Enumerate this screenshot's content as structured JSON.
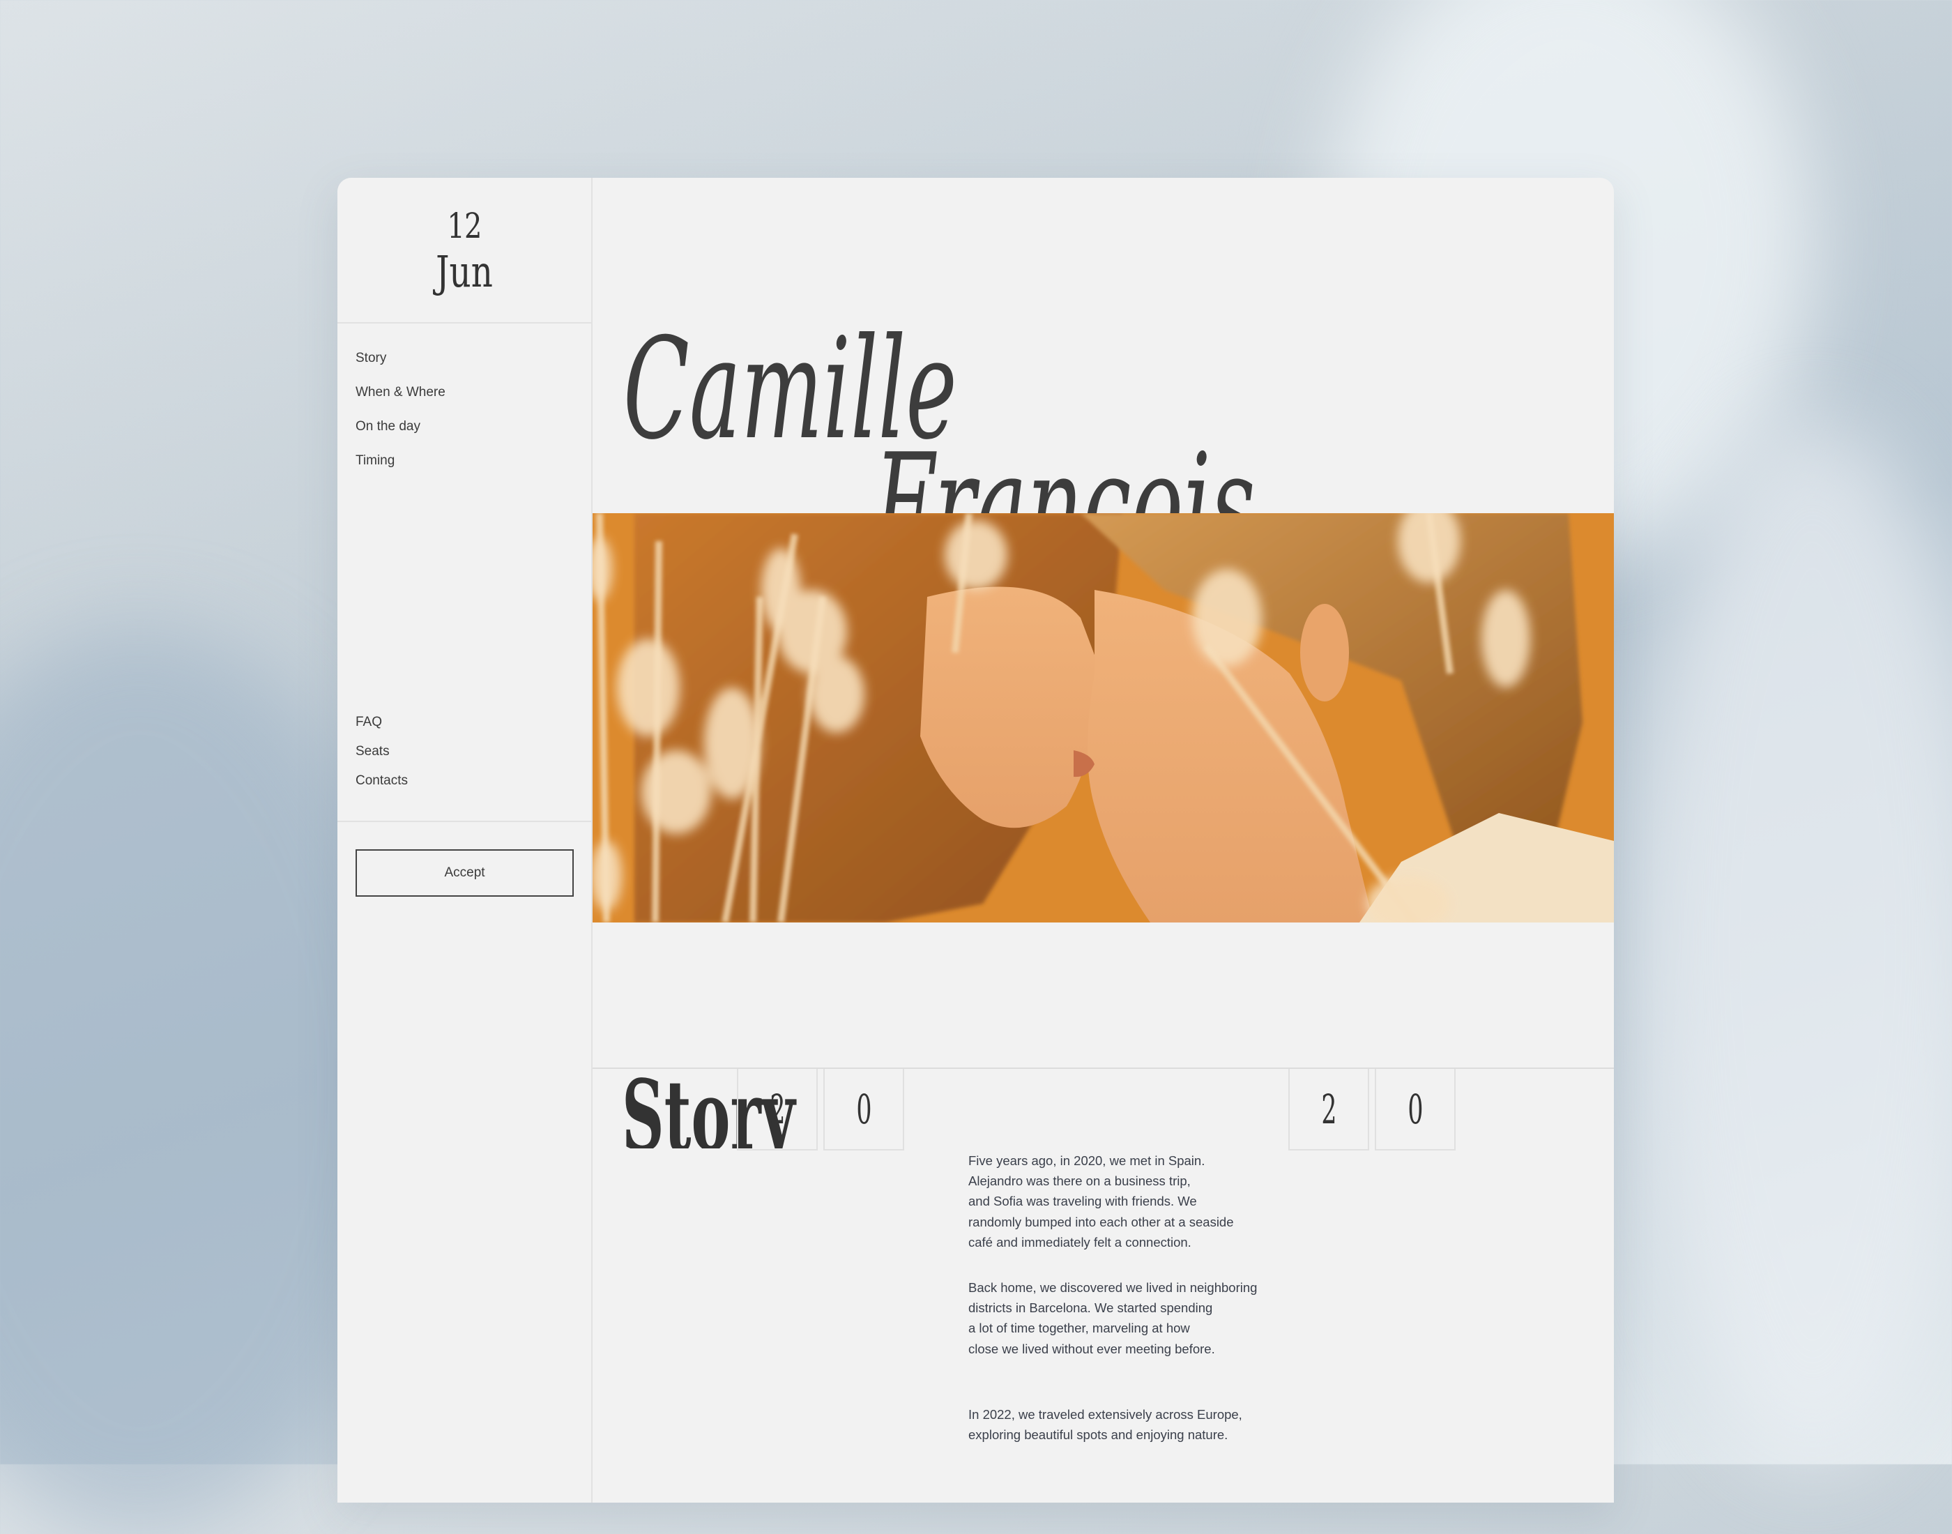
{
  "sidebar": {
    "date": {
      "day": "12",
      "month": "Jun"
    },
    "nav_top": [
      "Story",
      "When & Where",
      "On the day",
      "Timing"
    ],
    "nav_bottom": [
      "FAQ",
      "Seats",
      "Contacts"
    ],
    "accept_label": "Accept"
  },
  "hero": {
    "first_name": "Camille",
    "last_name": "Francois",
    "photo_alt": "Couple kissing among dried flower stems on orange background",
    "photo_accent": "#d9862c"
  },
  "story": {
    "heading": "Story",
    "year_left": [
      "2",
      "0"
    ],
    "year_right": [
      "2",
      "0"
    ],
    "paragraphs": [
      "Five years ago, in 2020, we met in Spain.\nAlejandro was there on a business trip,\nand Sofia was traveling with friends. We\nrandomly bumped into each other at a seaside\ncafé and immediately felt a connection.",
      "Back home, we discovered we lived in neighboring\ndistricts in Barcelona. We started spending\na lot of time together, marveling at how\nclose we lived without ever meeting before.",
      "In 2022, we traveled extensively across Europe,\nexploring beautiful spots and enjoying nature."
    ]
  }
}
